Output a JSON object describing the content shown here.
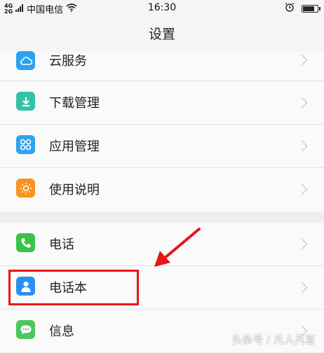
{
  "status_bar": {
    "network_top": "4G",
    "network_bottom": "2G",
    "carrier": "中国电信",
    "wifi_icon": "wifi-icon",
    "time": "16:30",
    "alarm_icon": "alarm-icon",
    "battery_level": 0.8
  },
  "header": {
    "title": "设置"
  },
  "groups": [
    {
      "items": [
        {
          "label": "云服务",
          "icon": "cloud-icon",
          "color": "#2ba3f0"
        },
        {
          "label": "下载管理",
          "icon": "download-icon",
          "color": "#36c2a6"
        },
        {
          "label": "应用管理",
          "icon": "apps-icon",
          "color": "#2ba3f0"
        },
        {
          "label": "使用说明",
          "icon": "bulb-icon",
          "color": "#f7931e"
        }
      ]
    },
    {
      "items": [
        {
          "label": "电话",
          "icon": "phone-icon",
          "color": "#3cc24b"
        },
        {
          "label": "电话本",
          "icon": "contacts-icon",
          "color": "#2b8ff0"
        },
        {
          "label": "信息",
          "icon": "message-icon",
          "color": "#4cc75e"
        }
      ]
    }
  ],
  "annotation": {
    "highlight_color": "#e8141b"
  },
  "watermark": "头条号 / 凡人凡言"
}
